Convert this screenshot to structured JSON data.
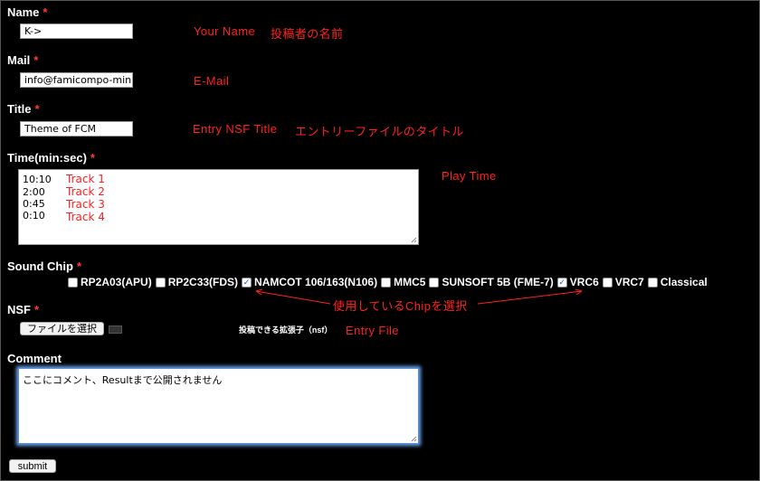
{
  "required_mark": "*",
  "fields": {
    "name": {
      "label": "Name",
      "value": "K->",
      "note_en": "Your Name",
      "note_ja": "投稿者の名前"
    },
    "mail": {
      "label": "Mail",
      "value": "info@famicompo-mini.com",
      "note": "E-Mail"
    },
    "title": {
      "label": "Title",
      "value": "Theme of FCM",
      "note_en": "Entry NSF Title",
      "note_ja": "エントリーファイルのタイトル"
    },
    "time": {
      "label": "Time(min:sec)",
      "note": "Play Time",
      "tracks": [
        {
          "time": "10:10",
          "name": "Track 1"
        },
        {
          "time": "2:00",
          "name": "Track 2"
        },
        {
          "time": "0:45",
          "name": "Track 3"
        },
        {
          "time": "0:10",
          "name": "Track 4"
        }
      ]
    },
    "sound_chip": {
      "label": "Sound Chip",
      "note": "使用しているChipを選択",
      "options": [
        {
          "label": "RP2A03(APU)",
          "checked": false
        },
        {
          "label": "RP2C33(FDS)",
          "checked": false
        },
        {
          "label": "NAMCOT 106/163(N106)",
          "checked": true
        },
        {
          "label": "MMC5",
          "checked": false
        },
        {
          "label": "SUNSOFT 5B (FME-7)",
          "checked": false
        },
        {
          "label": "VRC6",
          "checked": true
        },
        {
          "label": "VRC7",
          "checked": false
        },
        {
          "label": "Classical",
          "checked": false
        }
      ]
    },
    "nsf": {
      "label": "NSF",
      "button": "ファイルを選択",
      "hint": "投稿できる拡張子（nsf）",
      "note": "Entry File"
    },
    "comment": {
      "label": "Comment",
      "value": "ここにコメント、Resultまで公開されません"
    }
  },
  "submit_label": "submit",
  "colors": {
    "background": "#000000",
    "note": "#ff2020",
    "required": "#ff3b3b",
    "focus": "#6fa8f5"
  }
}
